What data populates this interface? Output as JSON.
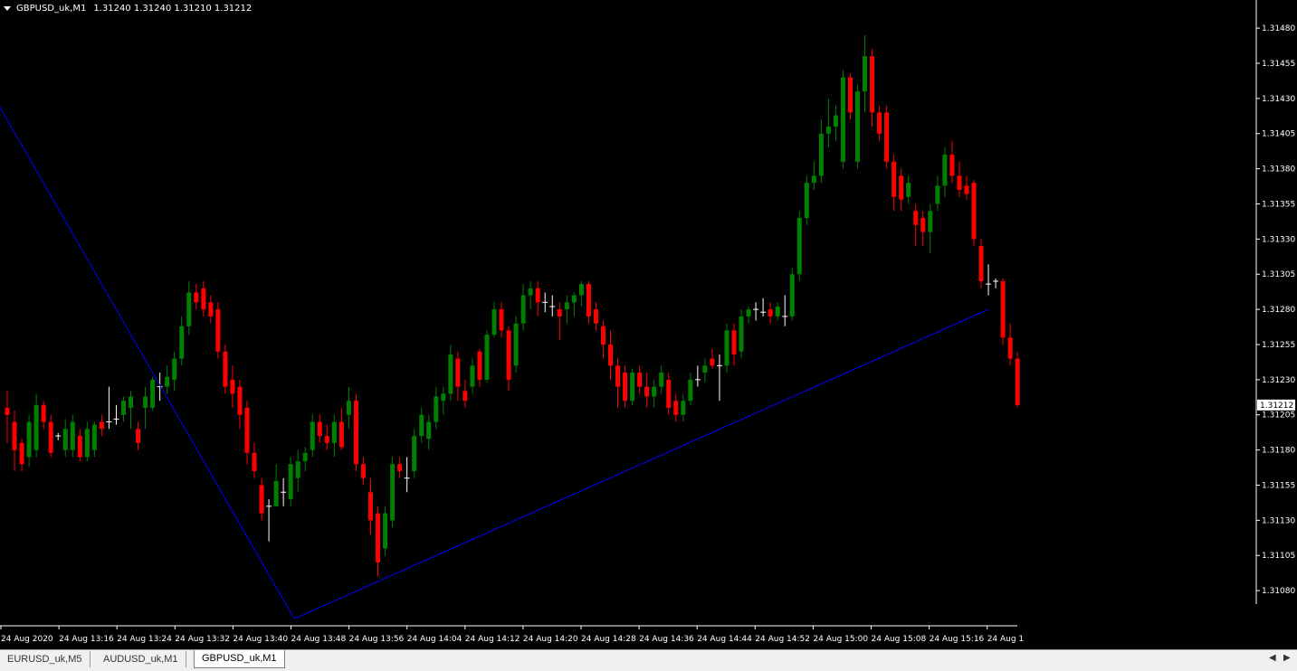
{
  "header": {
    "symbol_label": "GBPUSD_uk,M1",
    "ohlc": "1.31240 1.31240 1.31210 1.31212"
  },
  "tabs": [
    {
      "label": "EURUSD_uk,M5",
      "active": false
    },
    {
      "label": "AUDUSD_uk,M1",
      "active": false
    },
    {
      "label": "GBPUSD_uk,M1",
      "active": true
    }
  ],
  "colors": {
    "bull": "#008000",
    "bear": "#ff0000",
    "doji": "#ffffff",
    "trendline": "#0000ff",
    "axis": "#ffffff"
  },
  "icons": {
    "menu": "triangle-down-icon",
    "scroll_left": "left-arrow-icon",
    "scroll_right": "right-arrow-icon"
  },
  "chart_data": {
    "type": "candlestick",
    "symbol": "GBPUSD_uk",
    "timeframe": "M1",
    "ylim": [
      1.31055,
      1.315
    ],
    "yticks": [
      "1.31480",
      "1.31455",
      "1.31430",
      "1.31405",
      "1.31380",
      "1.31355",
      "1.31330",
      "1.31305",
      "1.31280",
      "1.31255",
      "1.31230",
      "1.31205",
      "1.31180",
      "1.31155",
      "1.31130",
      "1.31105",
      "1.31080"
    ],
    "xticks": [
      "24 Aug 2020",
      "24 Aug 13:16",
      "24 Aug 13:24",
      "24 Aug 13:32",
      "24 Aug 13:40",
      "24 Aug 13:48",
      "24 Aug 13:56",
      "24 Aug 14:04",
      "24 Aug 14:12",
      "24 Aug 14:20",
      "24 Aug 14:28",
      "24 Aug 14:36",
      "24 Aug 14:44",
      "24 Aug 14:52",
      "24 Aug 15:00",
      "24 Aug 15:08",
      "24 Aug 15:16",
      "24 Aug 1"
    ],
    "current_price": "1.31212",
    "candles": [
      [
        1.3121,
        1.31222,
        1.31185,
        1.31205
      ],
      [
        1.312,
        1.31208,
        1.31165,
        1.3118
      ],
      [
        1.31185,
        1.31188,
        1.31165,
        1.3117
      ],
      [
        1.31175,
        1.31205,
        1.31168,
        1.312
      ],
      [
        1.3118,
        1.3122,
        1.31175,
        1.31212
      ],
      [
        1.31212,
        1.31215,
        1.31195,
        1.312
      ],
      [
        1.312,
        1.31205,
        1.31175,
        1.31178
      ],
      [
        1.3119,
        1.31192,
        1.31187,
        1.3119
      ],
      [
        1.3118,
        1.31202,
        1.31175,
        1.31195
      ],
      [
        1.3118,
        1.31205,
        1.31175,
        1.312
      ],
      [
        1.3119,
        1.31195,
        1.31172,
        1.31175
      ],
      [
        1.31175,
        1.312,
        1.31172,
        1.31195
      ],
      [
        1.3118,
        1.312,
        1.31175,
        1.31198
      ],
      [
        1.312,
        1.31205,
        1.3119,
        1.31195
      ],
      [
        1.312,
        1.31225,
        1.31195,
        1.31202
      ],
      [
        1.31202,
        1.31212,
        1.31198,
        1.31205
      ],
      [
        1.31205,
        1.31218,
        1.312,
        1.31215
      ],
      [
        1.3121,
        1.31222,
        1.31195,
        1.31218
      ],
      [
        1.31195,
        1.312,
        1.3118,
        1.31185
      ],
      [
        1.3121,
        1.31225,
        1.31195,
        1.31218
      ],
      [
        1.3121,
        1.31232,
        1.31208,
        1.3123
      ],
      [
        1.31225,
        1.31235,
        1.31215,
        1.31228
      ],
      [
        1.31225,
        1.3124,
        1.3122,
        1.31232
      ],
      [
        1.3123,
        1.3125,
        1.31222,
        1.31245
      ],
      [
        1.31245,
        1.31275,
        1.3124,
        1.31268
      ],
      [
        1.31268,
        1.313,
        1.31262,
        1.31292
      ],
      [
        1.31292,
        1.31298,
        1.3128,
        1.31285
      ],
      [
        1.31295,
        1.313,
        1.31275,
        1.3128
      ],
      [
        1.31285,
        1.3129,
        1.3127,
        1.31275
      ],
      [
        1.3128,
        1.31285,
        1.31245,
        1.3125
      ],
      [
        1.3125,
        1.31255,
        1.3122,
        1.31225
      ],
      [
        1.3123,
        1.3124,
        1.3121,
        1.3122
      ],
      [
        1.31225,
        1.3123,
        1.31195,
        1.31205
      ],
      [
        1.3121,
        1.31215,
        1.3117,
        1.31178
      ],
      [
        1.31178,
        1.31185,
        1.3116,
        1.31165
      ],
      [
        1.31155,
        1.3116,
        1.3113,
        1.31135
      ],
      [
        1.3114,
        1.31145,
        1.31115,
        1.3114
      ],
      [
        1.3114,
        1.3117,
        1.3114,
        1.31158
      ],
      [
        1.3115,
        1.3116,
        1.3114,
        1.3115
      ],
      [
        1.31145,
        1.31175,
        1.3114,
        1.3117
      ],
      [
        1.3116,
        1.3118,
        1.3115,
        1.31172
      ],
      [
        1.31172,
        1.31182,
        1.31165,
        1.31178
      ],
      [
        1.3118,
        1.31205,
        1.31175,
        1.312
      ],
      [
        1.312,
        1.31205,
        1.31185,
        1.3119
      ],
      [
        1.3119,
        1.31198,
        1.3118,
        1.31185
      ],
      [
        1.31185,
        1.31205,
        1.31175,
        1.312
      ],
      [
        1.312,
        1.3121,
        1.3118,
        1.31182
      ],
      [
        1.31205,
        1.31225,
        1.31195,
        1.31215
      ],
      [
        1.31215,
        1.3122,
        1.31165,
        1.3117
      ],
      [
        1.3117,
        1.31175,
        1.31155,
        1.3116
      ],
      [
        1.3115,
        1.3116,
        1.3112,
        1.3113
      ],
      [
        1.31135,
        1.3114,
        1.3109,
        1.311
      ],
      [
        1.3111,
        1.3114,
        1.31105,
        1.31135
      ],
      [
        1.3113,
        1.31175,
        1.31125,
        1.3117
      ],
      [
        1.3117,
        1.31175,
        1.3116,
        1.31165
      ],
      [
        1.3116,
        1.31175,
        1.3115,
        1.3116
      ],
      [
        1.31165,
        1.31195,
        1.3116,
        1.3119
      ],
      [
        1.3119,
        1.3121,
        1.31185,
        1.31205
      ],
      [
        1.31188,
        1.31205,
        1.3118,
        1.312
      ],
      [
        1.312,
        1.31225,
        1.31195,
        1.31218
      ],
      [
        1.31215,
        1.31225,
        1.31205,
        1.3122
      ],
      [
        1.3122,
        1.31255,
        1.31215,
        1.31248
      ],
      [
        1.31245,
        1.3125,
        1.31215,
        1.31225
      ],
      [
        1.31222,
        1.3123,
        1.3121,
        1.31215
      ],
      [
        1.31225,
        1.31245,
        1.3122,
        1.3124
      ],
      [
        1.3125,
        1.31252,
        1.31225,
        1.3123
      ],
      [
        1.3123,
        1.31265,
        1.31228,
        1.31262
      ],
      [
        1.31262,
        1.31285,
        1.3126,
        1.3128
      ],
      [
        1.3128,
        1.31285,
        1.3126,
        1.31265
      ],
      [
        1.31265,
        1.31268,
        1.31222,
        1.3123
      ],
      [
        1.3124,
        1.31275,
        1.31235,
        1.3127
      ],
      [
        1.3127,
        1.31298,
        1.31265,
        1.3129
      ],
      [
        1.3129,
        1.313,
        1.3128,
        1.31295
      ],
      [
        1.31295,
        1.313,
        1.31275,
        1.31285
      ],
      [
        1.31285,
        1.31292,
        1.31278,
        1.31282
      ],
      [
        1.31282,
        1.3129,
        1.31275,
        1.3128
      ],
      [
        1.3128,
        1.31285,
        1.31258,
        1.31275
      ],
      [
        1.3128,
        1.3129,
        1.3127,
        1.31285
      ],
      [
        1.31285,
        1.31292,
        1.31275,
        1.3129
      ],
      [
        1.3129,
        1.313,
        1.31282,
        1.31298
      ],
      [
        1.31298,
        1.313,
        1.3127,
        1.31275
      ],
      [
        1.3128,
        1.31285,
        1.31265,
        1.3127
      ],
      [
        1.31268,
        1.31272,
        1.31245,
        1.31255
      ],
      [
        1.31255,
        1.31265,
        1.3123,
        1.3124
      ],
      [
        1.3124,
        1.31245,
        1.3121,
        1.31225
      ],
      [
        1.31235,
        1.3124,
        1.3121,
        1.31215
      ],
      [
        1.31215,
        1.31238,
        1.31212,
        1.31235
      ],
      [
        1.31235,
        1.3124,
        1.3122,
        1.31225
      ],
      [
        1.31225,
        1.31235,
        1.3121,
        1.31218
      ],
      [
        1.31218,
        1.3123,
        1.3121,
        1.31225
      ],
      [
        1.31225,
        1.3124,
        1.3122,
        1.31235
      ],
      [
        1.3123,
        1.31235,
        1.31205,
        1.3121
      ],
      [
        1.31215,
        1.3122,
        1.312,
        1.31205
      ],
      [
        1.31205,
        1.3122,
        1.312,
        1.31215
      ],
      [
        1.31215,
        1.31235,
        1.31212,
        1.3123
      ],
      [
        1.3123,
        1.3124,
        1.31225,
        1.31232
      ],
      [
        1.31235,
        1.31245,
        1.31228,
        1.3124
      ],
      [
        1.31245,
        1.31252,
        1.31238,
        1.3124
      ],
      [
        1.3124,
        1.31248,
        1.31215,
        1.31242
      ],
      [
        1.3124,
        1.3127,
        1.31235,
        1.31265
      ],
      [
        1.31265,
        1.3127,
        1.3124,
        1.31248
      ],
      [
        1.3125,
        1.3128,
        1.31245,
        1.31275
      ],
      [
        1.31275,
        1.31282,
        1.3127,
        1.3128
      ],
      [
        1.3128,
        1.31285,
        1.31272,
        1.3128
      ],
      [
        1.31278,
        1.31288,
        1.31275,
        1.31278
      ],
      [
        1.3128,
        1.31285,
        1.3127,
        1.31275
      ],
      [
        1.31275,
        1.31285,
        1.31272,
        1.31282
      ],
      [
        1.31275,
        1.3129,
        1.31268,
        1.31275
      ],
      [
        1.31275,
        1.3131,
        1.31272,
        1.31305
      ],
      [
        1.31305,
        1.3135,
        1.313,
        1.31345
      ],
      [
        1.31345,
        1.31375,
        1.3134,
        1.3137
      ],
      [
        1.3137,
        1.31385,
        1.31365,
        1.31375
      ],
      [
        1.31375,
        1.31415,
        1.3137,
        1.31405
      ],
      [
        1.31405,
        1.3143,
        1.31395,
        1.3141
      ],
      [
        1.3141,
        1.31425,
        1.314,
        1.31418
      ],
      [
        1.31385,
        1.3145,
        1.3138,
        1.31445
      ],
      [
        1.31445,
        1.31448,
        1.31415,
        1.3142
      ],
      [
        1.31385,
        1.3144,
        1.3138,
        1.31435
      ],
      [
        1.31435,
        1.31475,
        1.3142,
        1.3146
      ],
      [
        1.3146,
        1.31465,
        1.3141,
        1.3142
      ],
      [
        1.3142,
        1.31425,
        1.314,
        1.31405
      ],
      [
        1.3142,
        1.31425,
        1.3138,
        1.31385
      ],
      [
        1.31385,
        1.3139,
        1.3135,
        1.3136
      ],
      [
        1.31375,
        1.3138,
        1.3135,
        1.31358
      ],
      [
        1.3136,
        1.31375,
        1.31355,
        1.3137
      ],
      [
        1.3135,
        1.31355,
        1.31325,
        1.3134
      ],
      [
        1.31345,
        1.3135,
        1.31325,
        1.31335
      ],
      [
        1.31335,
        1.31355,
        1.3132,
        1.3135
      ],
      [
        1.31355,
        1.31375,
        1.3135,
        1.31368
      ],
      [
        1.31368,
        1.31395,
        1.3136,
        1.3139
      ],
      [
        1.3139,
        1.314,
        1.3137,
        1.31375
      ],
      [
        1.31375,
        1.31385,
        1.3136,
        1.31365
      ],
      [
        1.31368,
        1.31375,
        1.31358,
        1.31362
      ],
      [
        1.3137,
        1.31372,
        1.31325,
        1.3133
      ],
      [
        1.31325,
        1.3133,
        1.31295,
        1.313
      ],
      [
        1.31298,
        1.31312,
        1.3129,
        1.313
      ],
      [
        1.313,
        1.31302,
        1.31295,
        1.313
      ],
      [
        1.313,
        1.31302,
        1.31255,
        1.3126
      ],
      [
        1.3126,
        1.3127,
        1.3124,
        1.31245
      ],
      [
        1.31245,
        1.3125,
        1.3121,
        1.31212
      ]
    ],
    "trendlines": [
      {
        "x": [
          -9.5,
          39.5
        ],
        "y": [
          1.315,
          1.3106
        ]
      },
      {
        "x": [
          39.5,
          135.0
        ],
        "y": [
          1.3106,
          1.3128
        ]
      }
    ]
  }
}
